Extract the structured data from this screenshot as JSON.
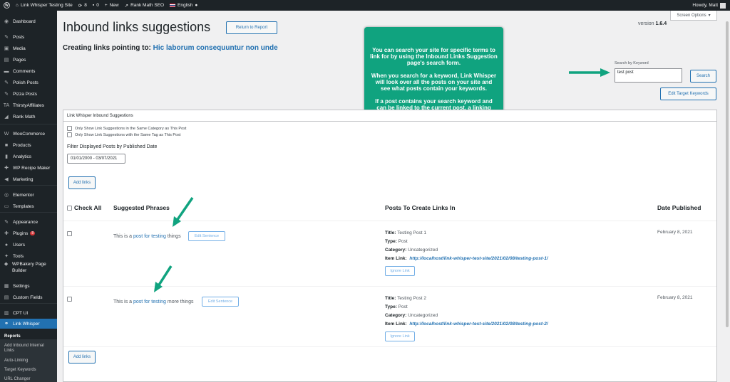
{
  "adminbar": {
    "site_name": "Link Whisper Testing Site",
    "updates_count": "8",
    "comments_count": "0",
    "new_label": "New",
    "rank_math": "Rank Math SEO",
    "language": "English",
    "howdy": "Howdy, Matt"
  },
  "sidebar": {
    "items": [
      {
        "label": "Dashboard",
        "icon": "dashboard-icon"
      },
      {
        "label": "Posts",
        "icon": "pin-icon"
      },
      {
        "label": "Media",
        "icon": "media-icon"
      },
      {
        "label": "Pages",
        "icon": "page-icon"
      },
      {
        "label": "Comments",
        "icon": "comment-icon"
      },
      {
        "label": "Polish Posts",
        "icon": "pin-icon"
      },
      {
        "label": "Pizza Posts",
        "icon": "pin-icon"
      },
      {
        "label": "ThirstyAffiliates",
        "icon": "ta-icon"
      },
      {
        "label": "Rank Math",
        "icon": "chart-icon"
      },
      {
        "label": "WooCommerce",
        "icon": "woo-icon"
      },
      {
        "label": "Products",
        "icon": "products-icon"
      },
      {
        "label": "Analytics",
        "icon": "bar-chart-icon"
      },
      {
        "label": "WP Recipe Maker",
        "icon": "recipe-icon"
      },
      {
        "label": "Marketing",
        "icon": "megaphone-icon"
      },
      {
        "label": "Elementor",
        "icon": "elementor-icon"
      },
      {
        "label": "Templates",
        "icon": "folder-icon"
      },
      {
        "label": "Appearance",
        "icon": "brush-icon"
      },
      {
        "label": "Plugins",
        "icon": "plugin-icon",
        "badge": "8"
      },
      {
        "label": "Users",
        "icon": "user-icon"
      },
      {
        "label": "Tools",
        "icon": "wrench-icon"
      },
      {
        "label": "WPBakery Page Builder",
        "icon": "wpbakery-icon"
      },
      {
        "label": "Settings",
        "icon": "settings-icon"
      },
      {
        "label": "Custom Fields",
        "icon": "fields-icon"
      },
      {
        "label": "CPT UI",
        "icon": "cpt-icon"
      },
      {
        "label": "Link Whisper",
        "icon": "link-icon"
      }
    ],
    "submenu": [
      "Reports",
      "Add Inbound Internal Links",
      "Auto-Linking",
      "Target Keywords",
      "URL Changer"
    ]
  },
  "page": {
    "title": "Inbound links suggestions",
    "return_button": "Return to Report",
    "screen_options": "Screen Options",
    "version_label": "version",
    "version": "1.6.4",
    "subtitle_prefix": "Creating links pointing to:",
    "subtitle_link": "Hic laborum consequuntur non unde"
  },
  "search": {
    "label": "Search by Keyword",
    "value": "test post",
    "button": "Search",
    "edit_keywords_button": "Edit Target Keywords"
  },
  "callout": {
    "p1": "You can search your site for specific terms to link for by using the Inbound Links Suggestion page's search form.",
    "p2": "When you search for a keyword, Link Whisper will look over all the posts on your site and see what posts contain your keywords.",
    "p3": "If a post contains your search keyword and can be linked to the current post, a linking suggestion will be made."
  },
  "panel": {
    "header": "Link Whisper Inbound Suggestions",
    "opt_category": "Only Show Link Suggestions in the Same Category as This Post",
    "opt_tag": "Only Show Link Suggestions with the Same Tag as This Post",
    "filter_label": "Filter Displayed Posts by Published Date",
    "date_range": "01/01/2000 - 03/07/2021",
    "add_links": "Add links",
    "col_check_all": "Check All",
    "col_phrases": "Suggested Phrases",
    "col_posts": "Posts To Create Links In",
    "col_date": "Date Published",
    "edit_sentence": "Edit Sentence",
    "ignore_link": "Ignore Link",
    "title_label": "Title:",
    "type_label": "Type:",
    "category_label": "Category:",
    "item_link_label": "Item Link:"
  },
  "rows": [
    {
      "phrase_before": "This is a",
      "phrase_link": "post for testing",
      "phrase_after": "things",
      "title": "Testing Post 1",
      "type": "Post",
      "category": "Uncategorized",
      "item_link": "http://localhost/link-whisper-test-site/2021/02/08/testing-post-1/",
      "date": "February 8, 2021"
    },
    {
      "phrase_before": "This is a",
      "phrase_link": "post for testing",
      "phrase_after": "more things",
      "title": "Testing Post 2",
      "type": "Post",
      "category": "Uncategorized",
      "item_link": "http://localhost/link-whisper-test-site/2021/02/08/testing-post-2/",
      "date": "February 8, 2021"
    }
  ],
  "colors": {
    "accent": "#2271b1",
    "callout": "#10a37f",
    "sidebar": "#1d2327"
  }
}
